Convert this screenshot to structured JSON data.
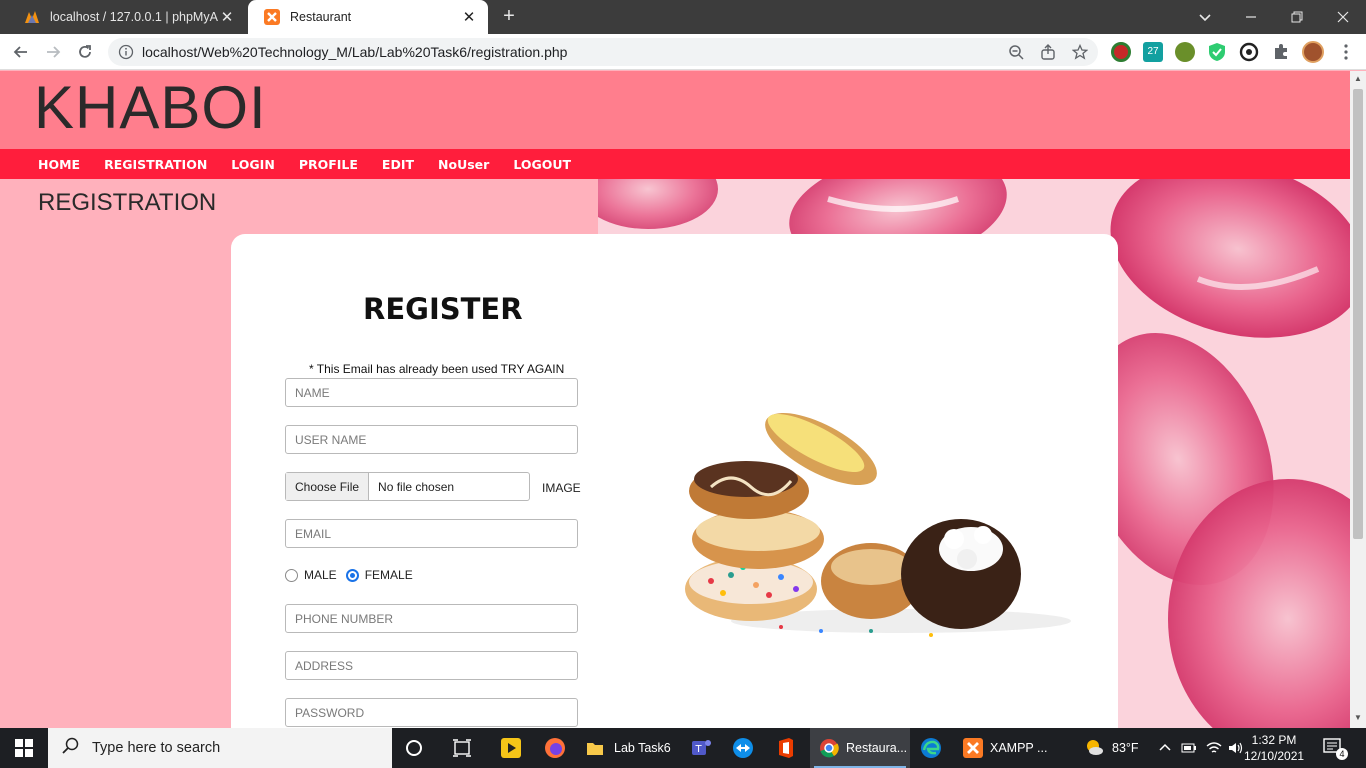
{
  "browser": {
    "tabs": [
      {
        "title": "localhost / 127.0.0.1 | phpMyAdmin",
        "active": false
      },
      {
        "title": "Restaurant",
        "active": true
      }
    ],
    "url": "localhost/Web%20Technology_M/Lab/Lab%20Task6/registration.php"
  },
  "site": {
    "logo": "KHABOI",
    "nav": [
      "HOME",
      "REGISTRATION",
      "LOGIN",
      "PROFILE",
      "EDIT",
      "NoUser",
      "LOGOUT"
    ],
    "page_heading": "REGISTRATION"
  },
  "form": {
    "title": "REGISTER",
    "error": "* This Email has already been used TRY AGAIN",
    "name_placeholder": "NAME",
    "username_placeholder": "USER NAME",
    "file_button": "Choose File",
    "file_status": "No file chosen",
    "file_label": "IMAGE",
    "email_placeholder": "EMAIL",
    "gender_options": [
      "MALE",
      "FEMALE"
    ],
    "gender_selected": "FEMALE",
    "phone_placeholder": "PHONE NUMBER",
    "address_placeholder": "ADDRESS",
    "password_placeholder": "PASSWORD"
  },
  "taskbar": {
    "search_placeholder": "Type here to search",
    "items": [
      {
        "label": "",
        "icon": "cortana-icon"
      },
      {
        "label": "",
        "icon": "task-view-icon"
      },
      {
        "label": "",
        "icon": "pot-player-icon"
      },
      {
        "label": "",
        "icon": "firefox-icon"
      },
      {
        "label": "Lab Task6",
        "icon": "folder-icon"
      },
      {
        "label": "",
        "icon": "teams-icon"
      },
      {
        "label": "",
        "icon": "teamviewer-icon"
      },
      {
        "label": "",
        "icon": "office-icon"
      },
      {
        "label": "Restaura...",
        "icon": "chrome-icon"
      },
      {
        "label": "",
        "icon": "edge-icon"
      },
      {
        "label": "XAMPP ...",
        "icon": "xampp-icon"
      }
    ],
    "weather": "83°F",
    "time": "1:32 PM",
    "date": "12/10/2021",
    "notifications": "4"
  }
}
